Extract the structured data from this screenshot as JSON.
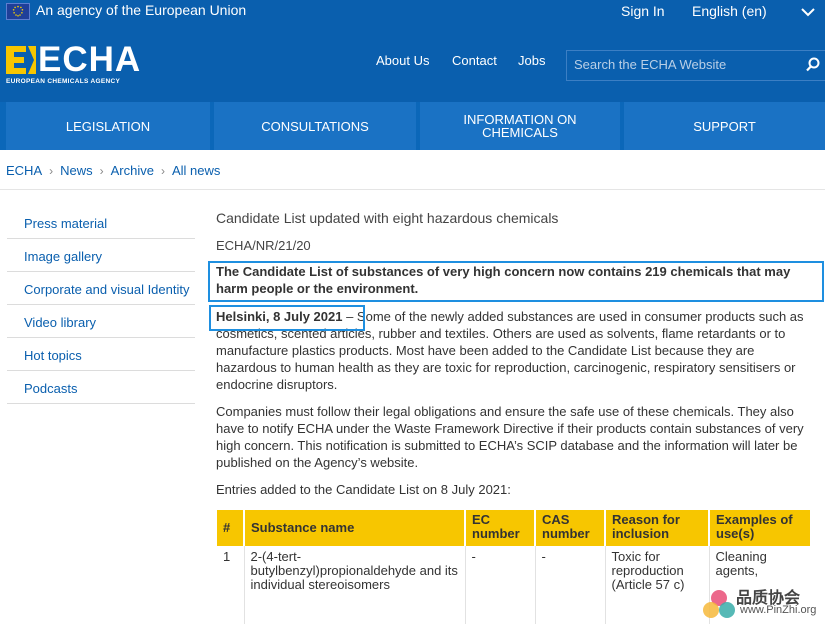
{
  "topbar": {
    "agency": "An agency of the European Union",
    "sign_in": "Sign In",
    "language": "English (en)"
  },
  "header": {
    "logo_word": "ECHA",
    "logo_sub": "EUROPEAN CHEMICALS AGENCY",
    "links": [
      "About Us",
      "Contact",
      "Jobs"
    ],
    "search_placeholder": "Search the ECHA Website"
  },
  "mainnav": {
    "items": [
      "LEGISLATION",
      "CONSULTATIONS",
      "INFORMATION ON CHEMICALS",
      "SUPPORT"
    ]
  },
  "breadcrumb": [
    "ECHA",
    "News",
    "Archive",
    "All news"
  ],
  "sidebar": {
    "items": [
      "Press material",
      "Image gallery",
      "Corporate and visual Identity",
      "Video library",
      "Hot topics",
      "Podcasts"
    ]
  },
  "article": {
    "title": "Candidate List updated with eight hazardous chemicals",
    "ref": "ECHA/NR/21/20",
    "lead": "The Candidate List of substances of very high concern now contains 219 chemicals that may harm people or the environment.",
    "dateline": "Helsinki, 8 July 2021",
    "para1": " – Some of the newly added substances are used in consumer products such as cosmetics, scented articles, rubber and textiles. Others are used as solvents, flame retardants or to manufacture plastics products. Most have been added to the Candidate List because they are hazardous to human health as they are toxic for reproduction, carcinogenic, respiratory sensitisers or endocrine disruptors.",
    "para2": "Companies must follow their legal obligations and ensure the safe use of these chemicals. They also have to notify ECHA under the Waste Framework Directive if their products contain substances of very high concern. This notification is submitted to ECHA’s SCIP database and the information will later be published on the Agency’s website.",
    "entries_intro": "Entries added to the Candidate List on 8 July 2021:"
  },
  "table": {
    "headers": [
      "#",
      "Substance name",
      "EC number",
      "CAS number",
      "Reason for inclusion",
      "Examples of use(s)"
    ],
    "rows": [
      [
        "1",
        "2-(4-tert-butylbenzyl)propionaldehyde and its individual stereoisomers",
        "-",
        "-",
        "Toxic for reproduction (Article 57 c)",
        "Cleaning agents,"
      ]
    ]
  },
  "watermark": {
    "cn": "品质协会",
    "url": "www.PinZhi.org"
  },
  "colors": {
    "brand_blue": "#0a5fae",
    "nav_blue": "#1a72c4",
    "table_header": "#f7c600",
    "highlight_box": "#1e8fe0"
  }
}
